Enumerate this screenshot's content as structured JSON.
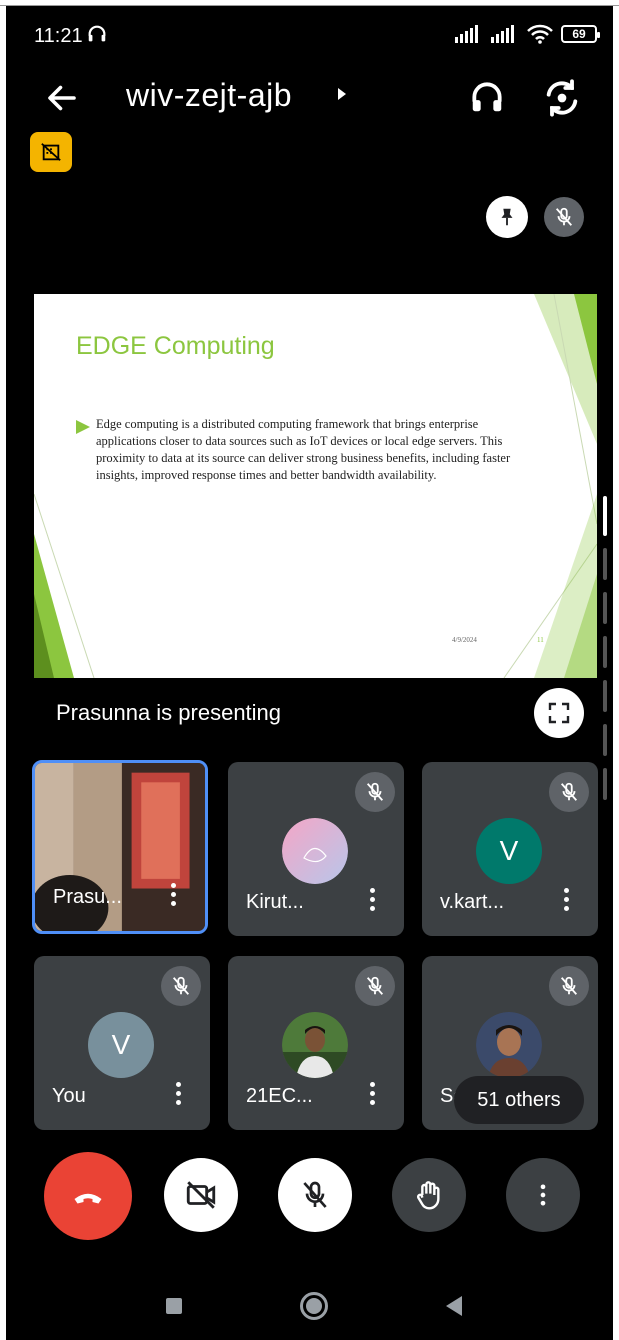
{
  "status_bar": {
    "time": "11:21",
    "battery": "69"
  },
  "header": {
    "meeting_code": "wiv-zejt-ajb"
  },
  "presentation": {
    "slide_title": "EDGE Computing",
    "slide_body": "Edge computing is a distributed computing framework that brings enterprise applications closer to data sources such as IoT devices or local edge servers. This proximity to data at its source can deliver strong business benefits, including faster insights, improved response times and better bandwidth availability.",
    "slide_date": "4/9/2024",
    "slide_page": "11",
    "presenting_label": "Prasunna is presenting"
  },
  "participants": [
    {
      "name": "Prasu...",
      "type": "video",
      "muted": false,
      "active": true
    },
    {
      "name": "Kirut...",
      "type": "avatar-image",
      "muted": true
    },
    {
      "name": "v.kart...",
      "type": "initial",
      "initial": "V",
      "color": "#00796b",
      "muted": true
    },
    {
      "name": "You",
      "type": "initial",
      "initial": "V",
      "color": "#78909c",
      "muted": true
    },
    {
      "name": "21EC...",
      "type": "photo",
      "muted": true
    },
    {
      "name": "Sa...",
      "type": "photo",
      "muted": true
    }
  ],
  "others_label": "51 others",
  "colors": {
    "end_call": "#ea4335",
    "accent": "#4f8ff7",
    "slide_green": "#8cc63f",
    "rec_badge": "#f4b400"
  }
}
